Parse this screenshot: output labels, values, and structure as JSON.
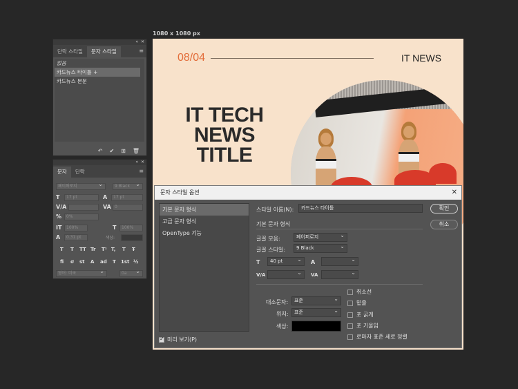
{
  "canvas": {
    "size_label": "1080 x 1080 px",
    "date": "08/04",
    "brand": "IT NEWS",
    "title_lines": [
      "IT TECH",
      "NEWS",
      "TITLE"
    ],
    "bg_color": "#f8e2cb",
    "accent_color": "#e36d3a"
  },
  "char_styles_panel": {
    "tabs": [
      "단락 스타일",
      "문자 스타일"
    ],
    "active_tab": "문자 스타일",
    "items": [
      "없음",
      "카드뉴스 타이틀 +",
      "카드뉴스 본문"
    ],
    "selected_index": 1,
    "footer_icons": [
      "reset-icon",
      "check-icon",
      "new-style-icon",
      "trash-icon"
    ]
  },
  "character_panel": {
    "tabs": [
      "문자",
      "단락"
    ],
    "font_family": "페이퍼로지",
    "font_style": "9 Black",
    "size": "17 pt",
    "leading": "17 pt",
    "kerning": "",
    "tracking": "0",
    "scale_pct": "0%",
    "vscale": "100%",
    "hscale": "100%",
    "baseline": "0.31 pt",
    "color_label": "색상:",
    "glyphs_1": [
      "T",
      "T",
      "TT",
      "Tr",
      "T¹",
      "T,",
      "T",
      "Ŧ"
    ],
    "glyphs_2": [
      "fi",
      "ơ",
      "st",
      "A",
      "ad",
      "T",
      "1st",
      "½"
    ],
    "language": "영어: 미국",
    "aa": "0a"
  },
  "dialog": {
    "title": "문자 스타일 옵션",
    "categories": [
      "기본 문자 형식",
      "고급 문자 형식",
      "OpenType 기능"
    ],
    "selected_category": 0,
    "preview_label": "미리 보기(P)",
    "preview_checked": true,
    "style_name_label": "스타일 이름(N):",
    "style_name_value": "카드뉴스 타이틀",
    "section_title": "기본 문자 형식",
    "font_family_label": "글꼴 모음:",
    "font_family_value": "페이퍼로지",
    "font_style_label": "글꼴 스타일:",
    "font_style_value": "9 Black",
    "size_value": "40 pt",
    "leading_value": "",
    "kerning_value": "",
    "tracking_value": "",
    "case_label": "대소문자:",
    "case_value": "표준",
    "position_label": "위치:",
    "position_value": "표준",
    "color_label": "색상:",
    "color_value": "#000000",
    "checks": [
      "취소선",
      "밑줄",
      "포 굵게",
      "포 기울임",
      "로마자 표준 세로 정렬"
    ],
    "ok_label": "확인",
    "cancel_label": "취소"
  }
}
